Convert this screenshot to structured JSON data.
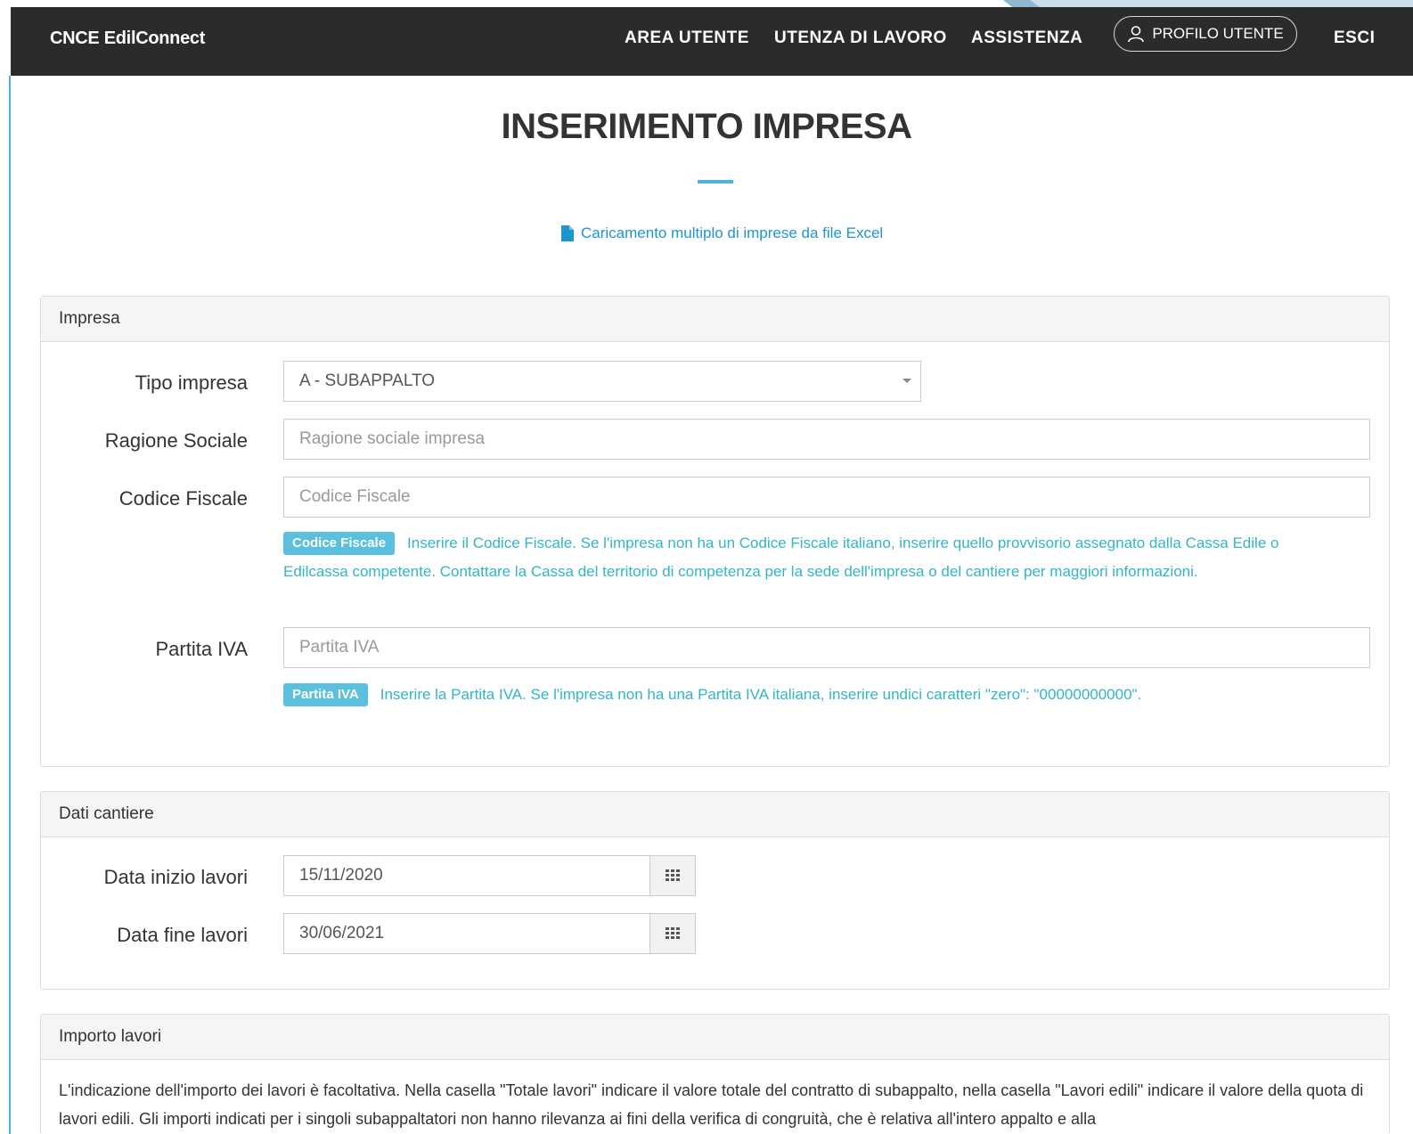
{
  "nav": {
    "brand": "CNCE EdilConnect",
    "area_utente": "AREA UTENTE",
    "utenza_di_lavoro": "UTENZA DI LAVORO",
    "assistenza": "ASSISTENZA",
    "profilo_utente": "PROFILO UTENTE",
    "esci": "ESCI"
  },
  "page": {
    "title": "INSERIMENTO IMPRESA",
    "excel_link": "Caricamento multiplo di imprese da file Excel"
  },
  "impresa": {
    "heading": "Impresa",
    "tipo_label": "Tipo impresa",
    "tipo_value": "A - SUBAPPALTO",
    "ragione_label": "Ragione Sociale",
    "ragione_placeholder": "Ragione sociale impresa",
    "cf_label": "Codice Fiscale",
    "cf_placeholder": "Codice Fiscale",
    "cf_badge": "Codice Fiscale",
    "cf_help": "Inserire il Codice Fiscale. Se l'impresa non ha un Codice Fiscale italiano, inserire quello provvisorio assegnato dalla Cassa Edile o Edilcassa competente. Contattare la Cassa del territorio di competenza per la sede dell'impresa o del cantiere per maggiori informazioni.",
    "piva_label": "Partita IVA",
    "piva_placeholder": "Partita IVA",
    "piva_badge": "Partita IVA",
    "piva_help": "Inserire la Partita IVA. Se l'impresa non ha una Partita IVA italiana, inserire undici caratteri \"zero\": \"00000000000\"."
  },
  "cantiere": {
    "heading": "Dati cantiere",
    "inizio_label": "Data inizio lavori",
    "inizio_value": "15/11/2020",
    "fine_label": "Data fine lavori",
    "fine_value": "30/06/2021"
  },
  "importo": {
    "heading": "Importo lavori",
    "text": "L'indicazione dell'importo dei lavori è facoltativa. Nella casella \"Totale lavori\" indicare il valore totale del contratto di subappalto, nella casella \"Lavori edili\" indicare il valore della quota di lavori edili. Gli importi indicati per i singoli subappaltatori non hanno rilevanza ai fini della verifica di congruità, che è relativa all'intero appalto e alla"
  },
  "colors": {
    "navbar": "#2b2b2b",
    "accent": "#4fb3e0",
    "badge": "#5bc0de",
    "help_text": "#33b5c8"
  }
}
